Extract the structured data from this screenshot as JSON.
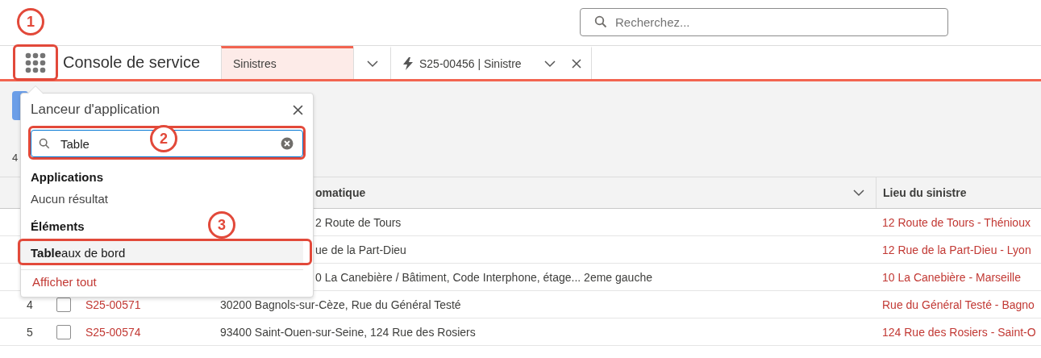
{
  "header": {
    "search": {
      "placeholder": "Recherchez..."
    }
  },
  "nav": {
    "app_name": "Console de service",
    "tabs": [
      {
        "kind": "list",
        "label": "Sinistres",
        "selected": true
      },
      {
        "kind": "record",
        "label": "S25-00456 | Sinistre",
        "selected": false
      }
    ]
  },
  "list_header": {
    "count": "4"
  },
  "table": {
    "columns": [
      "omatique",
      "Lieu du sinistre"
    ],
    "rows": [
      {
        "address": "2 Route de Tours",
        "place": "12 Route de Tours - Thénioux",
        "covered": true
      },
      {
        "address": "ue de la Part-Dieu",
        "place": "12 Rue de la Part-Dieu - Lyon",
        "covered": true
      },
      {
        "address": "0 La Canebière / Bâtiment, Code Interphone, étage... 2eme gauche",
        "place": "10 La Canebière - Marseille",
        "covered": true
      },
      {
        "number": "4",
        "checked": false,
        "id": "S25-00571",
        "address": "30200 Bagnols-sur-Cèze, Rue du Général Testé",
        "place": "Rue du Général Testé - Bagno",
        "covered": false
      },
      {
        "number": "5",
        "checked": false,
        "id": "S25-00574",
        "address": "93400 Saint-Ouen-sur-Seine, 124 Rue des Rosiers",
        "place": "124 Rue des Rosiers - Saint-O",
        "covered": false
      }
    ]
  },
  "app_launcher": {
    "title": "Lanceur d'application",
    "search_value": "Table",
    "sections": [
      {
        "heading": "Applications",
        "items": [
          {
            "kind": "empty",
            "label": "Aucun résultat",
            "selected": false
          }
        ]
      },
      {
        "heading": "Éléments",
        "items": [
          {
            "kind": "result",
            "label": "**Table**aux de bord",
            "selected": true
          }
        ]
      }
    ],
    "footer_link": "Afficher tout"
  },
  "annotations": [
    {
      "number": "1"
    },
    {
      "number": "2"
    },
    {
      "number": "3"
    }
  ]
}
